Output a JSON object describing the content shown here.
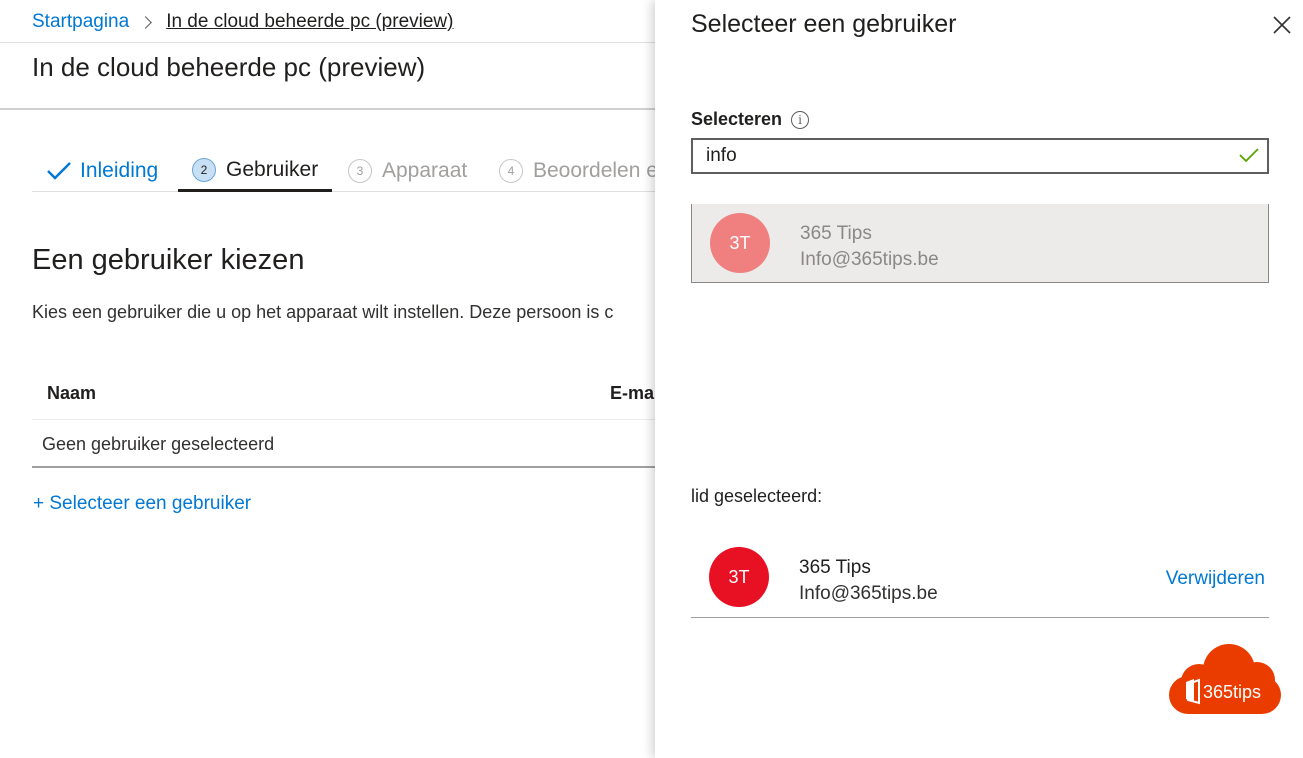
{
  "breadcrumb": {
    "home": "Startpagina",
    "current": "In de cloud beheerde pc (preview)"
  },
  "page": {
    "title": "In de cloud beheerde pc (preview)"
  },
  "wizard": {
    "steps": [
      {
        "number": "",
        "label": "Inleiding",
        "state": "completed"
      },
      {
        "number": "2",
        "label": "Gebruiker",
        "state": "active"
      },
      {
        "number": "3",
        "label": "Apparaat",
        "state": "inactive"
      },
      {
        "number": "4",
        "label": "Beoordelen e",
        "state": "inactive"
      }
    ]
  },
  "section": {
    "title": "Een gebruiker kiezen",
    "description": "Kies een gebruiker die u op het apparaat wilt instellen. Deze persoon is c"
  },
  "table": {
    "columns": [
      "Naam",
      "E-ma"
    ],
    "empty_text": "Geen gebruiker geselecteerd"
  },
  "add_user_link": "+ Selecteer een gebruiker",
  "panel": {
    "title": "Selecteer een gebruiker",
    "field_label": "Selecteren",
    "info_icon": "i",
    "search_value": "info",
    "results": [
      {
        "initials": "3T",
        "name": "365 Tips",
        "email": "Info@365tips.be"
      }
    ],
    "selected_label": "lid geselecteerd:",
    "selected": [
      {
        "initials": "3T",
        "name": "365 Tips",
        "email": "Info@365tips.be",
        "remove_label": "Verwijderen"
      }
    ]
  },
  "watermark": {
    "text": "365tips"
  },
  "colors": {
    "accent": "#0078d4",
    "avatar_result": "#f08080",
    "avatar_selected": "#e81123",
    "logo": "#eb3c00",
    "valid": "#57a300"
  },
  "icons": [
    "check-icon",
    "chevron-right-icon",
    "close-icon",
    "info-icon",
    "office-logo-icon"
  ]
}
